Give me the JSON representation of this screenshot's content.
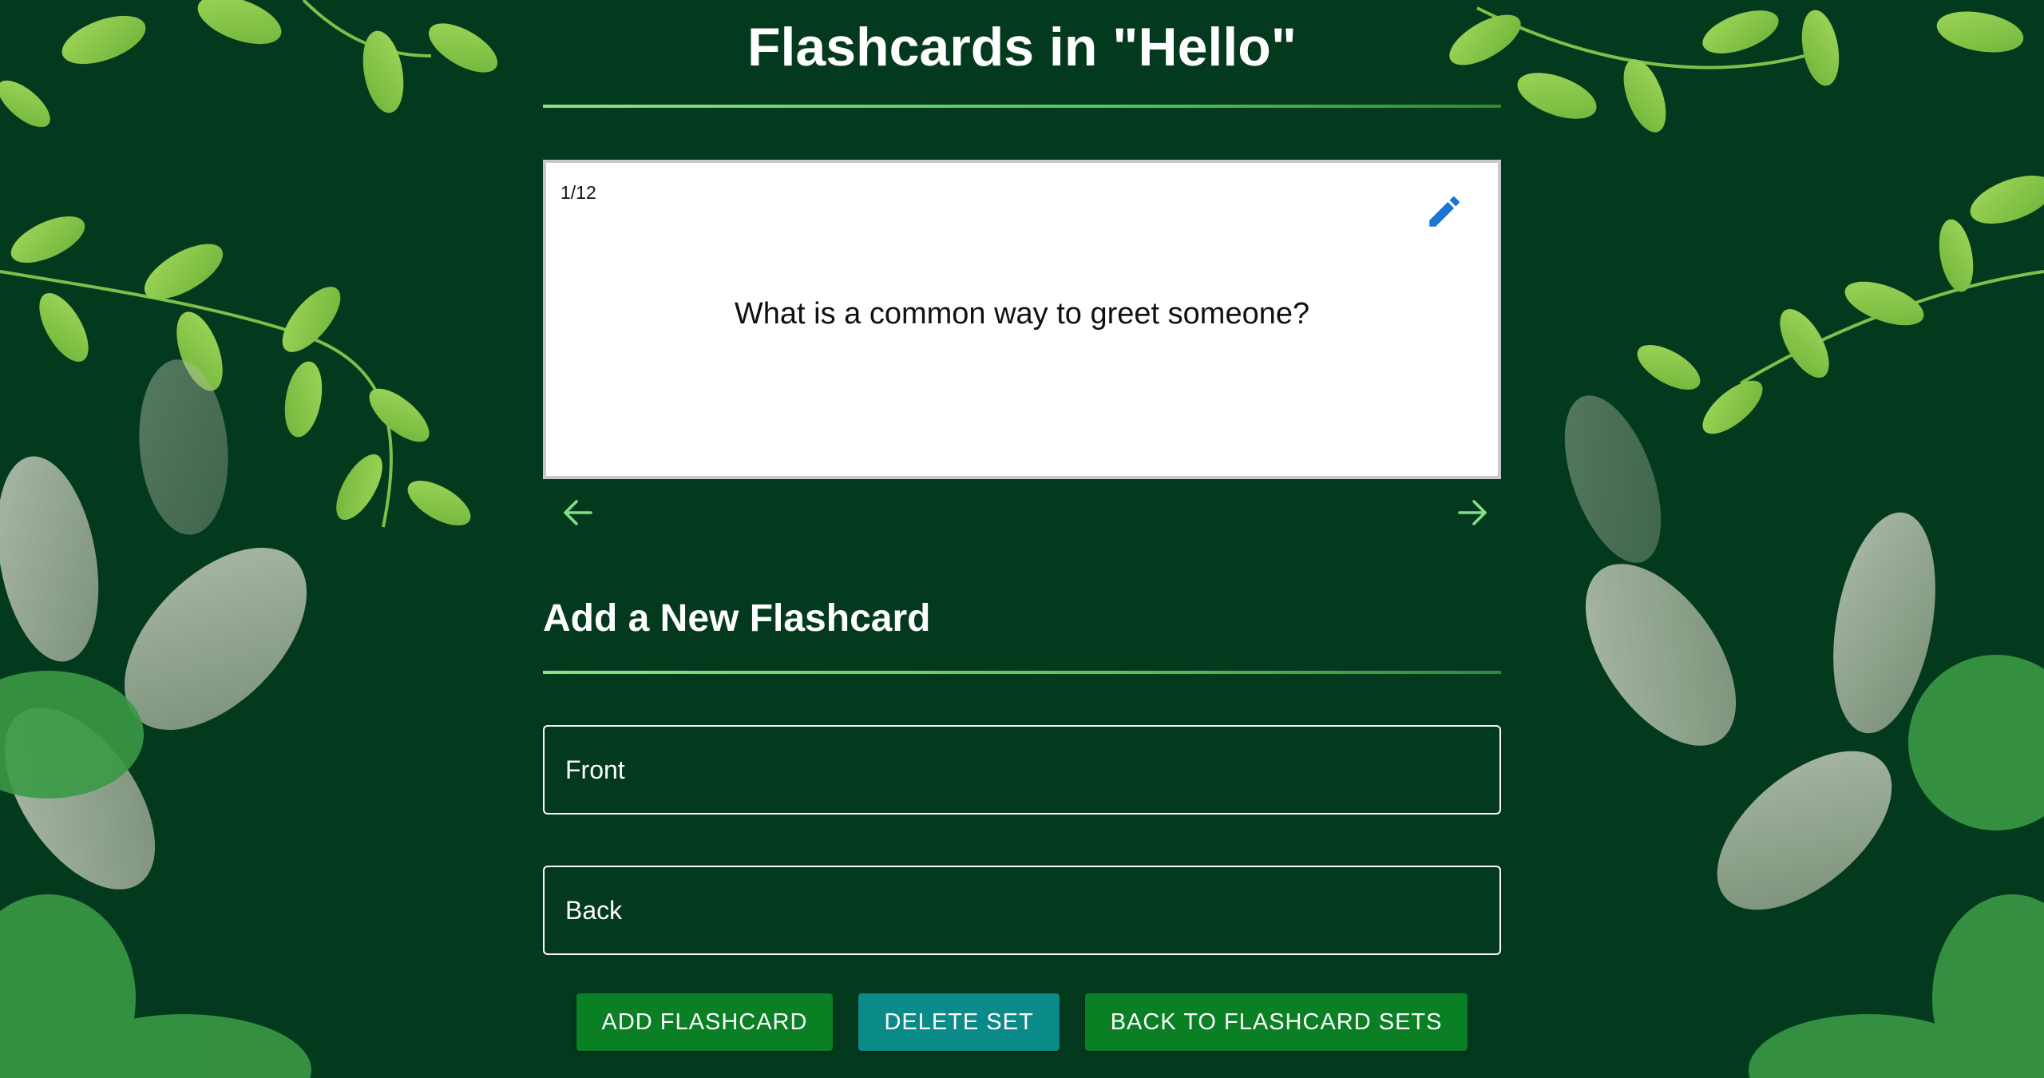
{
  "header": {
    "title": "Flashcards in \"Hello\""
  },
  "card": {
    "counter": "1/12",
    "question": "What is a common way to greet someone?",
    "edit_icon": "pencil-icon"
  },
  "navigation": {
    "prev_icon": "arrow-left-icon",
    "next_icon": "arrow-right-icon"
  },
  "new_card_form": {
    "heading": "Add a New Flashcard",
    "front_placeholder": "Front",
    "back_placeholder": "Back",
    "front_value": "",
    "back_value": ""
  },
  "actions": {
    "add_label": "ADD FLASHCARD",
    "delete_label": "DELETE SET",
    "back_label": "BACK TO FLASHCARD SETS"
  },
  "colors": {
    "background": "#033a1d",
    "edit_icon": "#1976d2",
    "nav_arrow": "#7fe08a",
    "add_button": "#0a7f24",
    "delete_button": "#0b8a8a",
    "back_button": "#0a7f24"
  }
}
